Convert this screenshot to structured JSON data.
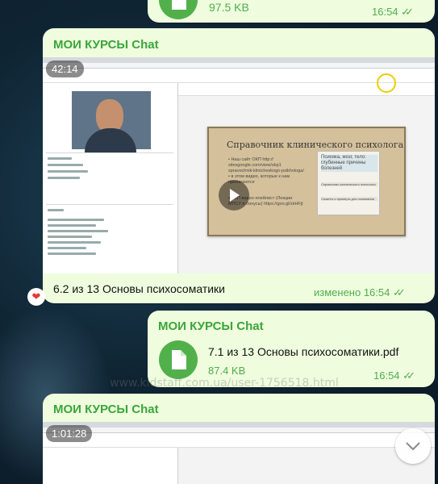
{
  "colors": {
    "bubble": "#effdde",
    "accent_green": "#3aa63a",
    "file_icon": "#52b04b"
  },
  "msg_top": {
    "size": "97.5 KB",
    "time": "16:54",
    "status_icon": "double-check-icon"
  },
  "video_msg_1": {
    "sender": "МОИ КУРСЫ Chat",
    "duration": "42:14",
    "caption": "6.2 из 13 Основы психосоматики",
    "edited_time": "изменено 16:54",
    "reaction": "heart-icon",
    "slide": {
      "title": "Справочник клинического психолога",
      "bullets": [
        "• Наш сайт ОКП http:// sitesgoogle.com/view/okp1 spravochnik-klinicheskogo-psikhologa/ • в этом видео, которые к нам прилагаются",
        "• ОКП видео-плейлист (Лекции МПСУ и бонусы) https://goo.gl/zkHFjt"
      ],
      "box": [
        "Психика, мозг, тело: глубинные причины болезней",
        "Справочник клинического психолога",
        "Сюжеты и примеры для понимания"
      ]
    }
  },
  "file_msg": {
    "sender": "МОИ КУРСЫ Chat",
    "filename": "7.1 из 13 Основы психосоматики.pdf",
    "size": "87.4 KB",
    "time": "16:54"
  },
  "watermark": "www.kidstaff.com.ua/user-1756518.html",
  "video_msg_2": {
    "sender": "МОИ КУРСЫ Chat",
    "duration": "1:01:28"
  },
  "scroll_down": "chevron-down-icon"
}
